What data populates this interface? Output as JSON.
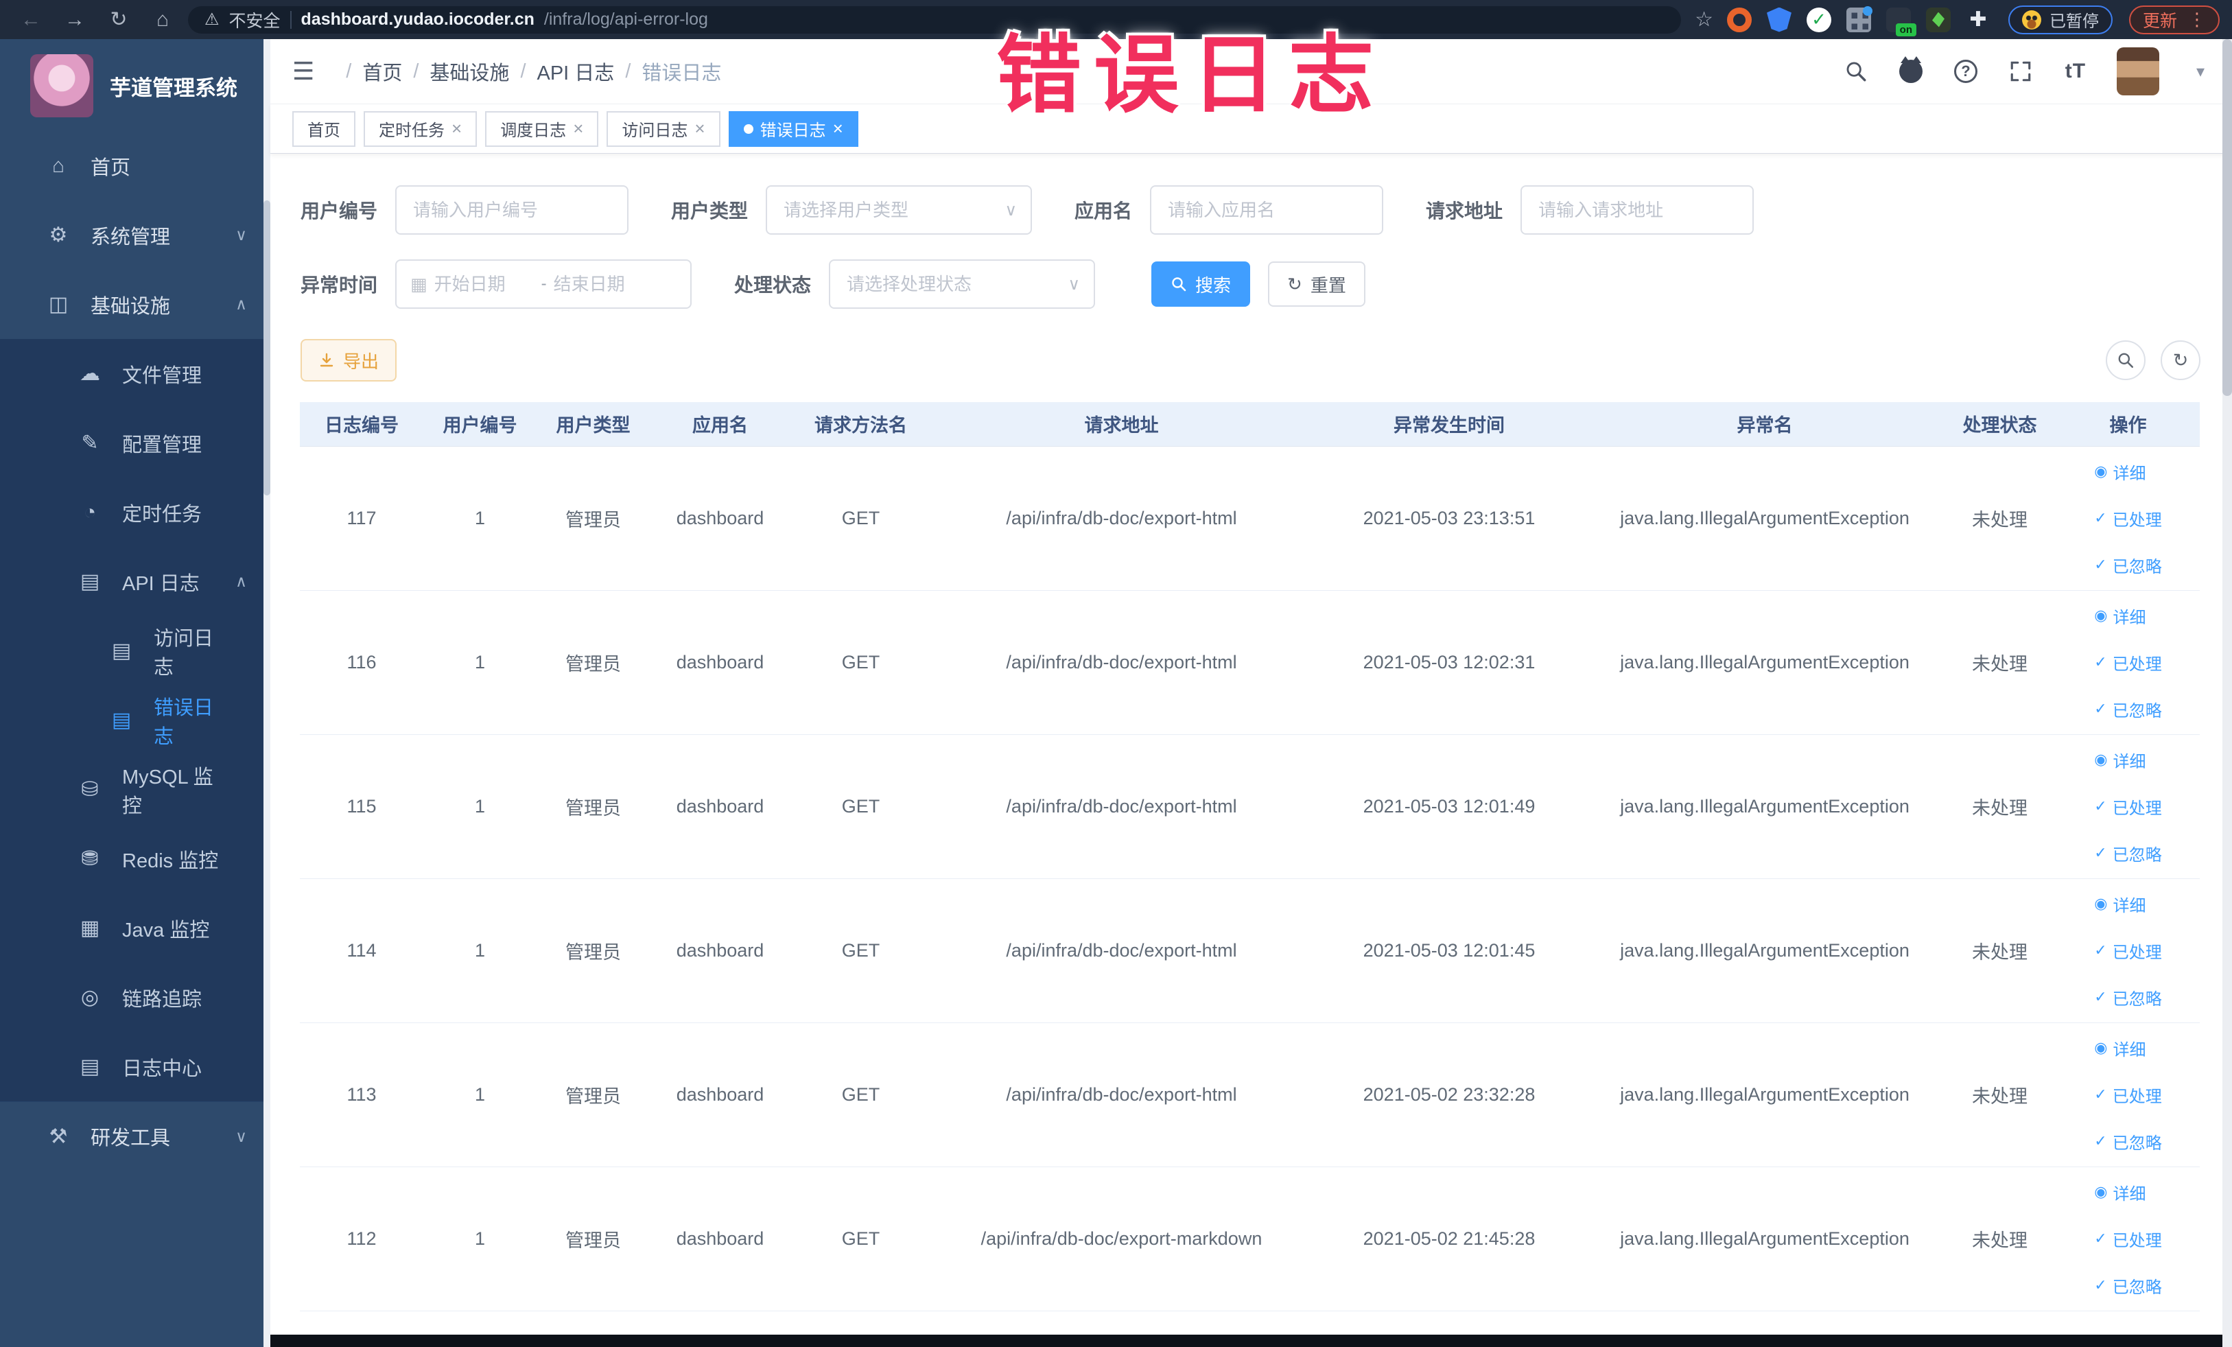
{
  "colors": {
    "accent": "#409eff",
    "annotation": "#f12f5d",
    "export": "#e6a23c",
    "sidebar_bg": "#2e4a6c",
    "submenu_bg": "#21395c"
  },
  "browser": {
    "back_icon": "←",
    "forward_icon": "→",
    "reload_icon": "↻",
    "home_icon": "⌂",
    "warning_icon": "⚠",
    "security_label": "不安全",
    "url_domain": "dashboard.yudao.iocoder.cn",
    "url_path": "/infra/log/api-error-log",
    "star_icon": "☆",
    "on_badge": "on",
    "check_glyph": "✓",
    "paused_label": "已暂停",
    "update_label": "更新",
    "menu_dots_icon": "⋮",
    "puzzle_glyph": "✚"
  },
  "annotation": {
    "text": "错误日志"
  },
  "sidebar": {
    "title": "芋道管理系统",
    "items": [
      {
        "name": "home-icon",
        "glyph": "⌂",
        "label": "首页",
        "cls": "lvl1",
        "chevron": ""
      },
      {
        "name": "system-icon",
        "glyph": "⚙",
        "label": "系统管理",
        "cls": "lvl1",
        "chevron": "∨"
      },
      {
        "name": "infra-icon",
        "glyph": "◫",
        "label": "基础设施",
        "cls": "lvl1",
        "chevron": "∧"
      },
      {
        "name": "file-icon",
        "glyph": "☁",
        "label": "文件管理",
        "cls": "lvl2",
        "chevron": ""
      },
      {
        "name": "config-icon",
        "glyph": "✎",
        "label": "配置管理",
        "cls": "lvl2",
        "chevron": ""
      },
      {
        "name": "timer-icon",
        "glyph": "◔",
        "label": "定时任务",
        "cls": "lvl2",
        "chevron": ""
      },
      {
        "name": "api-log-icon",
        "glyph": "▤",
        "label": "API 日志",
        "cls": "lvl2",
        "chevron": "∧"
      },
      {
        "name": "access-log-icon",
        "glyph": "▤",
        "label": "访问日志",
        "cls": "lvl3",
        "chevron": ""
      },
      {
        "name": "error-log-icon",
        "glyph": "▤",
        "label": "错误日志",
        "cls": "lvl3 active",
        "chevron": ""
      },
      {
        "name": "mysql-icon",
        "glyph": "⛁",
        "label": "MySQL 监控",
        "cls": "lvl2",
        "chevron": ""
      },
      {
        "name": "redis-icon",
        "glyph": "⛃",
        "label": "Redis 监控",
        "cls": "lvl2",
        "chevron": ""
      },
      {
        "name": "java-icon",
        "glyph": "▦",
        "label": "Java 监控",
        "cls": "lvl2",
        "chevron": ""
      },
      {
        "name": "trace-icon",
        "glyph": "◎",
        "label": "链路追踪",
        "cls": "lvl2",
        "chevron": ""
      },
      {
        "name": "log-center-icon",
        "glyph": "▤",
        "label": "日志中心",
        "cls": "lvl2",
        "chevron": ""
      },
      {
        "name": "devtools-icon",
        "glyph": "⚒",
        "label": "研发工具",
        "cls": "lvl1 devtools",
        "chevron": "∨"
      }
    ]
  },
  "header": {
    "hamburger_icon": "☰",
    "breadcrumb_separator": "/",
    "breadcrumbs": [
      {
        "label": "首页",
        "cls": ""
      },
      {
        "label": "基础设施",
        "cls": ""
      },
      {
        "label": "API 日志",
        "cls": ""
      },
      {
        "label": "错误日志",
        "cls": "current"
      }
    ],
    "help_glyph": "?",
    "font_size_glyph": "tT",
    "caret_icon": "▾"
  },
  "tabs": {
    "close_icon": "×",
    "items": [
      {
        "label": "首页",
        "cls": "no-close"
      },
      {
        "label": "定时任务",
        "cls": ""
      },
      {
        "label": "调度日志",
        "cls": ""
      },
      {
        "label": "访问日志",
        "cls": ""
      },
      {
        "label": "错误日志",
        "cls": "active"
      }
    ]
  },
  "filters": {
    "user_id_label": "用户编号",
    "user_id_placeholder": "请输入用户编号",
    "user_type_label": "用户类型",
    "user_type_placeholder": "请选择用户类型",
    "app_name_label": "应用名",
    "app_name_placeholder": "请输入应用名",
    "request_url_label": "请求地址",
    "request_url_placeholder": "请输入请求地址",
    "exception_time_label": "异常时间",
    "calendar_icon": "▦",
    "start_placeholder": "开始日期",
    "range_separator": "-",
    "end_placeholder": "结束日期",
    "process_status_label": "处理状态",
    "process_status_placeholder": "请选择处理状态",
    "select_caret_icon": "∨",
    "search_label": "搜索",
    "reset_label": "重置",
    "reset_icon": "↻"
  },
  "toolbar": {
    "export_label": "导出",
    "refresh_icon": "↻"
  },
  "table": {
    "columns": [
      "日志编号",
      "用户编号",
      "用户类型",
      "应用名",
      "请求方法名",
      "请求地址",
      "异常发生时间",
      "异常名",
      "处理状态",
      "操作"
    ],
    "actions": [
      {
        "icon": "eye-icon",
        "glyph": "◉",
        "label": "详细"
      },
      {
        "icon": "check-icon",
        "glyph": "✓",
        "label": "已处理"
      },
      {
        "icon": "check-icon",
        "glyph": "✓",
        "label": "已忽略"
      }
    ],
    "rows": [
      {
        "id": "117",
        "user_id": "1",
        "user_type": "管理员",
        "app": "dashboard",
        "method": "GET",
        "url": "/api/infra/db-doc/export-html",
        "time": "2021-05-03 23:13:51",
        "exception": "java.lang.IllegalArgumentException",
        "status": "未处理"
      },
      {
        "id": "116",
        "user_id": "1",
        "user_type": "管理员",
        "app": "dashboard",
        "method": "GET",
        "url": "/api/infra/db-doc/export-html",
        "time": "2021-05-03 12:02:31",
        "exception": "java.lang.IllegalArgumentException",
        "status": "未处理"
      },
      {
        "id": "115",
        "user_id": "1",
        "user_type": "管理员",
        "app": "dashboard",
        "method": "GET",
        "url": "/api/infra/db-doc/export-html",
        "time": "2021-05-03 12:01:49",
        "exception": "java.lang.IllegalArgumentException",
        "status": "未处理"
      },
      {
        "id": "114",
        "user_id": "1",
        "user_type": "管理员",
        "app": "dashboard",
        "method": "GET",
        "url": "/api/infra/db-doc/export-html",
        "time": "2021-05-03 12:01:45",
        "exception": "java.lang.IllegalArgumentException",
        "status": "未处理"
      },
      {
        "id": "113",
        "user_id": "1",
        "user_type": "管理员",
        "app": "dashboard",
        "method": "GET",
        "url": "/api/infra/db-doc/export-html",
        "time": "2021-05-02 23:32:28",
        "exception": "java.lang.IllegalArgumentException",
        "status": "未处理"
      },
      {
        "id": "112",
        "user_id": "1",
        "user_type": "管理员",
        "app": "dashboard",
        "method": "GET",
        "url": "/api/infra/db-doc/export-markdown",
        "time": "2021-05-02 21:45:28",
        "exception": "java.lang.IllegalArgumentException",
        "status": "未处理"
      }
    ]
  }
}
